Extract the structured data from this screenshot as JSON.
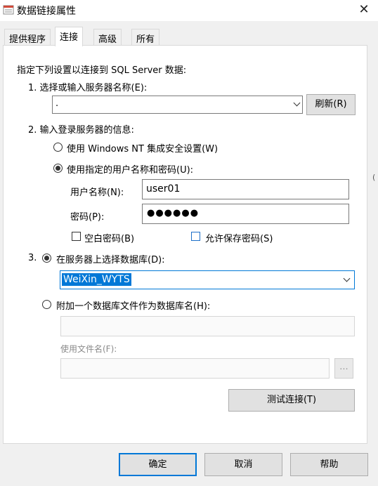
{
  "window": {
    "title": "数据链接属性",
    "close_glyph": "✕",
    "icon": "data-link-icon"
  },
  "tabs": [
    {
      "label": "提供程序",
      "active": false
    },
    {
      "label": "连接",
      "active": true
    },
    {
      "label": "高级",
      "active": false
    },
    {
      "label": "所有",
      "active": false
    }
  ],
  "connection": {
    "intro": "指定下列设置以连接到 SQL Server 数据:",
    "step1_label": "1. 选择或输入服务器名称(E):",
    "server_value": ".",
    "refresh_button": "刷新(R)",
    "step2_label": "2. 输入登录服务器的信息:",
    "radio_nt_auth": "使用 Windows NT 集成安全设置(W)",
    "radio_user_pass": "使用指定的用户名称和密码(U):",
    "username_label": "用户名称(N):",
    "username_value": "user01",
    "password_label": "密码(P):",
    "password_masked": "●●●●●●",
    "blank_password_label": "空白密码(B)",
    "allow_save_password_label": "允许保存密码(S)",
    "step3_prefix": "3.",
    "radio_select_db": "在服务器上选择数据库(D):",
    "database_value": "WeiXin_WYTS",
    "radio_attach_file": "附加一个数据库文件作为数据库名(H):",
    "attach_db_name_value": "",
    "use_filename_label": "使用文件名(F):",
    "filename_value": "",
    "browse_button": "...",
    "test_connection_button": "测试连接(T)"
  },
  "footer": {
    "ok": "确定",
    "cancel": "取消",
    "help": "帮助"
  },
  "edge_fragment": "(",
  "colors": {
    "accent": "#0078d7",
    "panel_bg": "#ffffff",
    "window_bg": "#f0f0f0"
  }
}
